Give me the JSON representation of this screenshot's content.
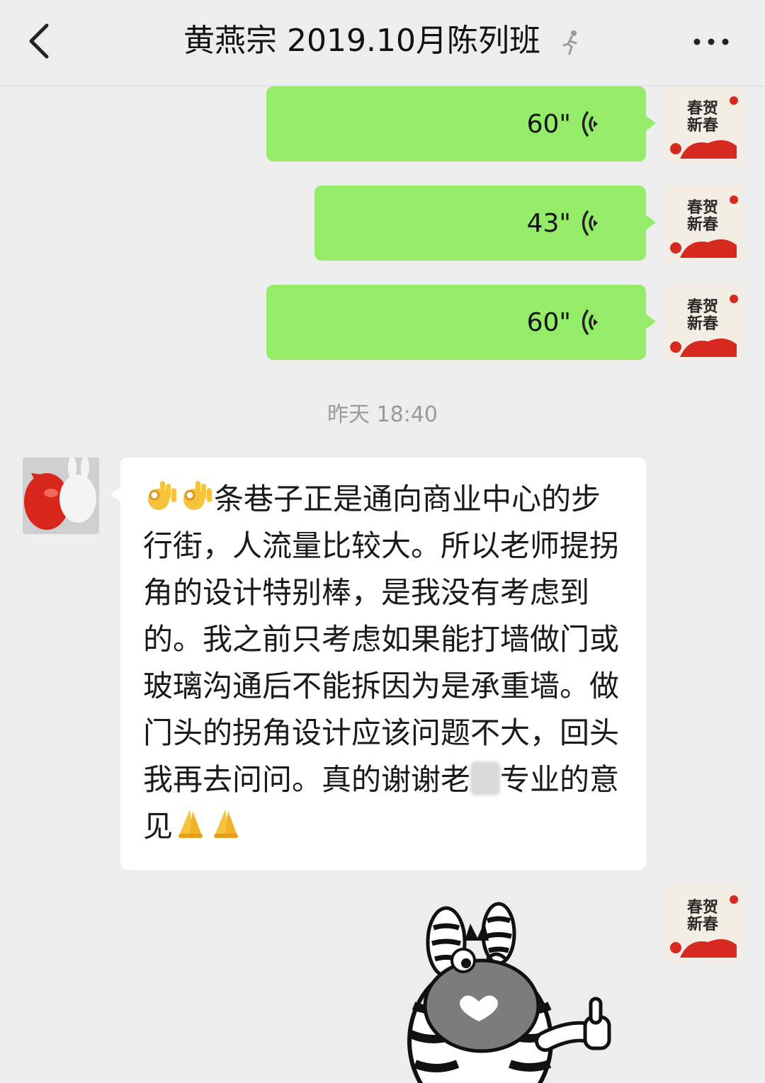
{
  "header": {
    "title": "黄燕宗 2019.10月陈列班",
    "back_icon": "chevron-left-icon",
    "status_icon": "walking-person-icon",
    "more_icon": "more-dots-icon"
  },
  "messages": {
    "voice": [
      {
        "duration": "60\""
      },
      {
        "duration": "43\""
      },
      {
        "duration": "60\""
      }
    ],
    "timestamp": "昨天 18:40",
    "text_message": {
      "part1": "条巷子正是通向商业中心的步行街，人流量比较大。所以老师提拐角的设计特别棒，是我没有考虑到的。我之前只考虑如果能打墙做门或玻璃沟通后不能拆因为是承重墙。做门头的拐角设计应该问题不大，回头我再去问问。真的谢谢老",
      "part2": "专业的意见",
      "leading_emoji": "ok-hand-emoji",
      "trailing_emoji": "praying-hands-emoji"
    },
    "sticker": "zebra-sticker"
  },
  "colors": {
    "background": "#ededed",
    "my_bubble": "#95ec69",
    "their_bubble": "#ffffff"
  }
}
